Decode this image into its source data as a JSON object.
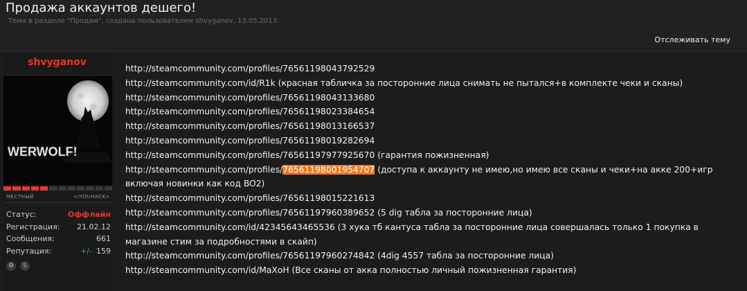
{
  "thread": {
    "title": "Продажа аккаунтов дешего!",
    "subtitle": "Тема в разделе \"Продам\", создана пользователем shvyganov, 13.05.2013.",
    "follow_label": "Отслеживать тему"
  },
  "user": {
    "name": "shvyganov",
    "avatar_text": "WERWOLF!",
    "rank": {
      "left": "МЕСТНЫЙ",
      "right": "</YOUHACK>",
      "level": 0.42
    },
    "stats": [
      {
        "label": "Статус:",
        "value": "Оффлайн"
      },
      {
        "label": "Регистрация:",
        "value": "21.02.12"
      },
      {
        "label": "Сообщения:",
        "value": "661"
      },
      {
        "label": "Репутация:",
        "prefix": "+/-",
        "value": "159"
      }
    ],
    "contact_icons": [
      "steam-icon",
      "skype-icon"
    ]
  },
  "post": {
    "lines": [
      {
        "url": "http://steamcommunity.com/profiles/76561198043792529",
        "note": ""
      },
      {
        "url": "http://steamcommunity.com/id/R1k",
        "note": " (красная табличка за посторонние лица снимать не пытался+в комплекте чеки и сканы)"
      },
      {
        "url": "http://steamcommunity.com/profiles/76561198043133680",
        "note": ""
      },
      {
        "url": "http://steamcommunity.com/profiles/76561198023384654",
        "note": ""
      },
      {
        "url": "http://steamcommunity.com/profiles/76561198013166537",
        "note": ""
      },
      {
        "url": "http://steamcommunity.com/profiles/76561198019282694",
        "note": ""
      },
      {
        "url": "http://steamcommunity.com/profiles/76561197977925670",
        "note": " (гарантия пожизненная)"
      },
      {
        "url_prefix": "http://steamcommunity.com/profiles/",
        "url_highlight": "76561198001954707",
        "note": " (доступа к аккаунту не имею,но имею все сканы и чеки+на акке 200+игр включая новинки как код BO2)"
      },
      {
        "url": "http://steamcommunity.com/profiles/76561198015221613",
        "note": ""
      },
      {
        "url": "http://steamcommunity.com/profiles/76561197960389652",
        "note": " (5 dig табла за посторонние лица)"
      },
      {
        "url": "http://steamcommunity.com/id/42345643465536",
        "note": " (3 хука тб кантуса табла за посторонние лица совершалась только 1 покупка в магазине стим за подробностями в скайп)"
      },
      {
        "url": "http://steamcommunity.com/profiles/76561197960274842",
        "note": " (4dig 4557 табла за посторонние лица)"
      },
      {
        "url": "http://steamcommunity.com/id/MaXoH",
        "note": " (Все сканы от акка полностью личный пожизненная гарантия)"
      }
    ]
  },
  "colors": {
    "background": "#212121",
    "username": "#e8342a",
    "offline": "#e8342a",
    "highlight": "#f07a1c",
    "rep_positive": "#3fb43f"
  }
}
